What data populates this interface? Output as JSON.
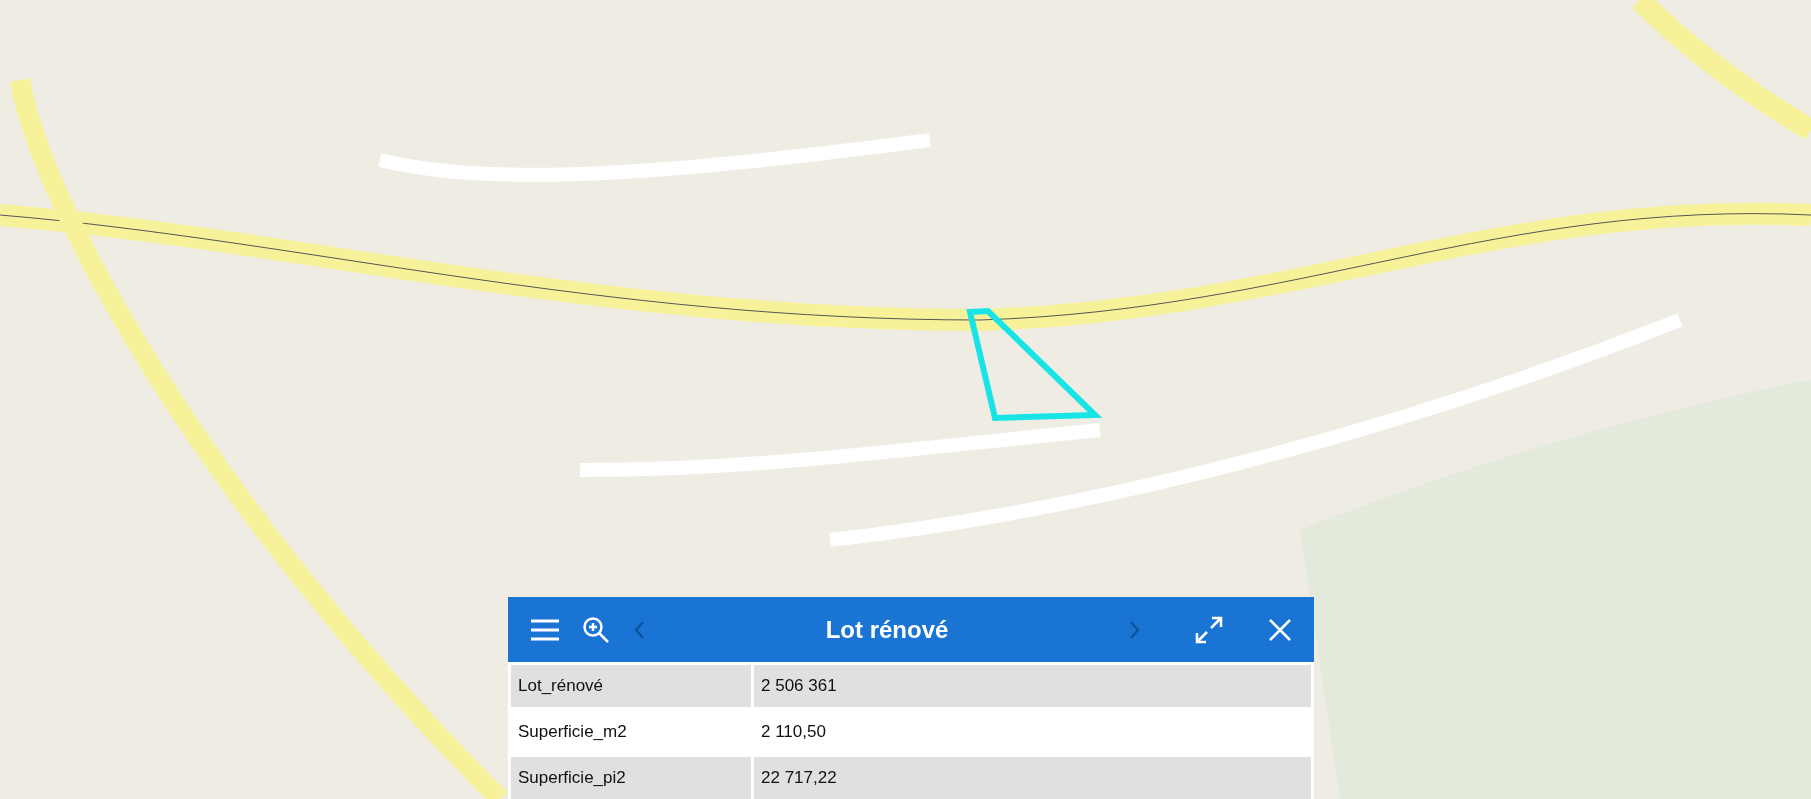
{
  "popup": {
    "title": "Lot rénové",
    "prev": {
      "disabled": true
    },
    "next": {
      "disabled": true
    },
    "rows": [
      {
        "label": "Lot_rénové",
        "value": "2 506 361",
        "shaded": true
      },
      {
        "label": "Superficie_m2",
        "value": "2 110,50",
        "shaded": false
      },
      {
        "label": "Superficie_pi2",
        "value": "22 717,22",
        "shaded": true
      }
    ]
  }
}
